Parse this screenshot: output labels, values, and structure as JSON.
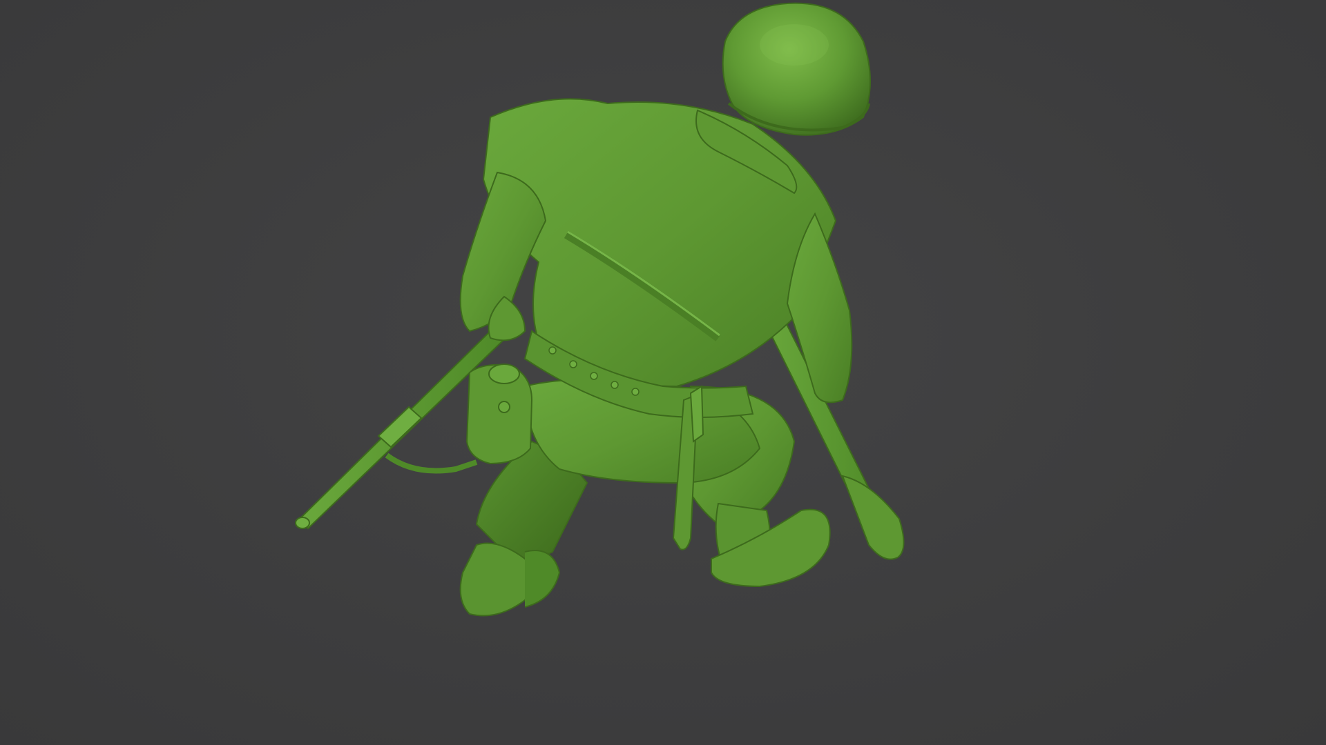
{
  "scene": {
    "background_color": "#3f3f40",
    "model_color": "#5f9a33",
    "subject": "toy-soldier-model"
  }
}
